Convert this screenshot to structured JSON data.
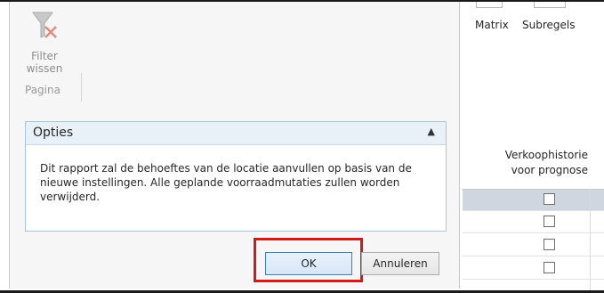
{
  "background": {
    "ribbon": {
      "matrix_label": "Matrix",
      "subregels_label": "Subregels"
    },
    "grid": {
      "column_header_line1": "Verkoophistorie",
      "column_header_line2": "voor prognose",
      "rows": [
        {
          "checked": false,
          "selected": true
        },
        {
          "checked": false,
          "selected": false
        },
        {
          "checked": false,
          "selected": false
        },
        {
          "checked": false,
          "selected": false
        }
      ]
    }
  },
  "dialog": {
    "ribbon": {
      "filter_clear_line1": "Filter",
      "filter_clear_line2": "wissen",
      "group_label": "Pagina",
      "filter_icon": "filter-clear-icon"
    },
    "options": {
      "title": "Opties",
      "collapse_icon": "chevron-up-icon",
      "message": "Dit rapport zal de behoeftes van de locatie aanvullen op basis van de nieuwe instellingen. Alle geplande voorraadmutaties zullen worden verwijderd."
    },
    "buttons": {
      "ok_label": "OK",
      "cancel_label": "Annuleren"
    },
    "highlight_color": "#d11a1a"
  }
}
